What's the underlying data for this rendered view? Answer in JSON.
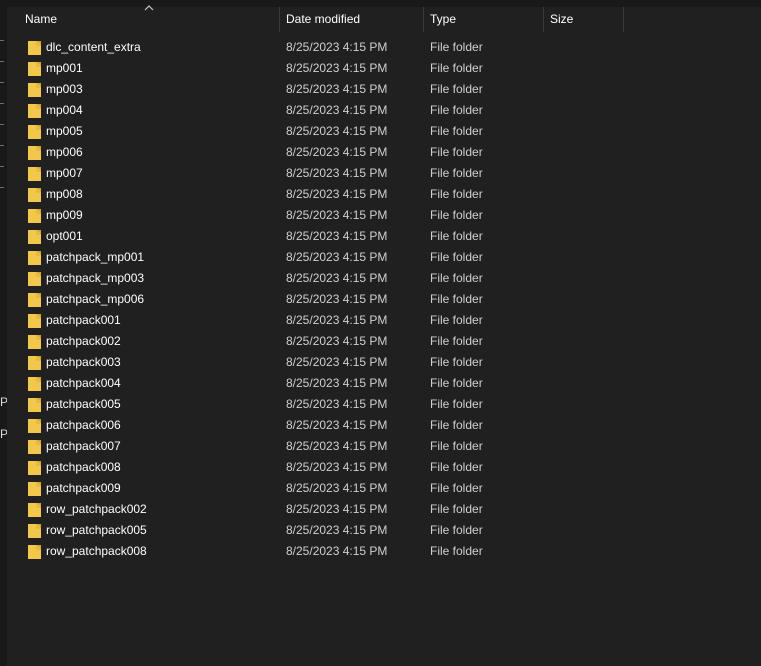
{
  "header": {
    "name": "Name",
    "date_modified": "Date modified",
    "type": "Type",
    "size": "Size"
  },
  "sort": {
    "column": "name",
    "icon": "sort-up-icon"
  },
  "nav_pane": {
    "glyphs": [
      "P",
      "P"
    ]
  },
  "files": [
    {
      "name": "dlc_content_extra",
      "date": "8/25/2023 4:15 PM",
      "type": "File folder",
      "icon": "folder-icon"
    },
    {
      "name": "mp001",
      "date": "8/25/2023 4:15 PM",
      "type": "File folder",
      "icon": "folder-icon"
    },
    {
      "name": "mp003",
      "date": "8/25/2023 4:15 PM",
      "type": "File folder",
      "icon": "folder-icon"
    },
    {
      "name": "mp004",
      "date": "8/25/2023 4:15 PM",
      "type": "File folder",
      "icon": "folder-icon"
    },
    {
      "name": "mp005",
      "date": "8/25/2023 4:15 PM",
      "type": "File folder",
      "icon": "folder-icon"
    },
    {
      "name": "mp006",
      "date": "8/25/2023 4:15 PM",
      "type": "File folder",
      "icon": "folder-icon"
    },
    {
      "name": "mp007",
      "date": "8/25/2023 4:15 PM",
      "type": "File folder",
      "icon": "folder-icon"
    },
    {
      "name": "mp008",
      "date": "8/25/2023 4:15 PM",
      "type": "File folder",
      "icon": "folder-icon"
    },
    {
      "name": "mp009",
      "date": "8/25/2023 4:15 PM",
      "type": "File folder",
      "icon": "folder-icon"
    },
    {
      "name": "opt001",
      "date": "8/25/2023 4:15 PM",
      "type": "File folder",
      "icon": "folder-icon"
    },
    {
      "name": "patchpack_mp001",
      "date": "8/25/2023 4:15 PM",
      "type": "File folder",
      "icon": "folder-icon"
    },
    {
      "name": "patchpack_mp003",
      "date": "8/25/2023 4:15 PM",
      "type": "File folder",
      "icon": "folder-icon"
    },
    {
      "name": "patchpack_mp006",
      "date": "8/25/2023 4:15 PM",
      "type": "File folder",
      "icon": "folder-icon"
    },
    {
      "name": "patchpack001",
      "date": "8/25/2023 4:15 PM",
      "type": "File folder",
      "icon": "folder-icon"
    },
    {
      "name": "patchpack002",
      "date": "8/25/2023 4:15 PM",
      "type": "File folder",
      "icon": "folder-icon"
    },
    {
      "name": "patchpack003",
      "date": "8/25/2023 4:15 PM",
      "type": "File folder",
      "icon": "folder-icon"
    },
    {
      "name": "patchpack004",
      "date": "8/25/2023 4:15 PM",
      "type": "File folder",
      "icon": "folder-icon"
    },
    {
      "name": "patchpack005",
      "date": "8/25/2023 4:15 PM",
      "type": "File folder",
      "icon": "folder-icon"
    },
    {
      "name": "patchpack006",
      "date": "8/25/2023 4:15 PM",
      "type": "File folder",
      "icon": "folder-icon"
    },
    {
      "name": "patchpack007",
      "date": "8/25/2023 4:15 PM",
      "type": "File folder",
      "icon": "folder-icon"
    },
    {
      "name": "patchpack008",
      "date": "8/25/2023 4:15 PM",
      "type": "File folder",
      "icon": "folder-icon"
    },
    {
      "name": "patchpack009",
      "date": "8/25/2023 4:15 PM",
      "type": "File folder",
      "icon": "folder-icon"
    },
    {
      "name": "row_patchpack002",
      "date": "8/25/2023 4:15 PM",
      "type": "File folder",
      "icon": "folder-icon"
    },
    {
      "name": "row_patchpack005",
      "date": "8/25/2023 4:15 PM",
      "type": "File folder",
      "icon": "folder-icon"
    },
    {
      "name": "row_patchpack008",
      "date": "8/25/2023 4:15 PM",
      "type": "File folder",
      "icon": "folder-icon"
    }
  ],
  "colors": {
    "background": "#202020",
    "folder": "#f3c84a",
    "folder_dark": "#d9a425",
    "text": "#ffffff",
    "muted_text": "#cfcfcf"
  }
}
